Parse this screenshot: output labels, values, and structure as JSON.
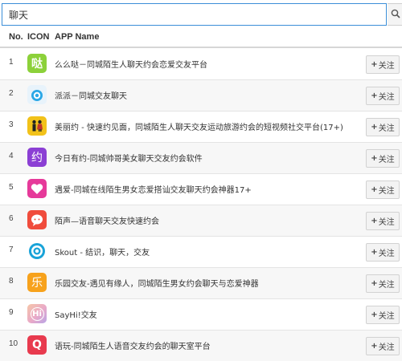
{
  "search": {
    "value": "聊天"
  },
  "table": {
    "headers": {
      "no": "No.",
      "icon": "ICON",
      "app_name": "APP Name"
    },
    "follow_label": "关注",
    "rows": [
      {
        "no": "1",
        "name": "么么哒－同城陌生人聊天约会恋爱交友平台",
        "icon": "momoda-app-icon",
        "icon_text": "哒",
        "icon_color": "#8cd13a"
      },
      {
        "no": "2",
        "name": "派派－同城交友聊天",
        "icon": "paipai-app-icon",
        "icon_text": "",
        "icon_color": "#2aa7e6"
      },
      {
        "no": "3",
        "name": "美丽约 - 快速约见面，同城陌生人聊天交友运动旅游约会的短视频社交平台(17+)",
        "icon": "meiliyue-app-icon",
        "icon_text": "",
        "icon_color": "#f2c21a"
      },
      {
        "no": "4",
        "name": "今日有约-同城帅哥美女聊天交友约会软件",
        "icon": "jinriyouyue-app-icon",
        "icon_text": "约",
        "icon_color": "#8b3fd4"
      },
      {
        "no": "5",
        "name": "遇爱-同城在线陌生男女恋爱搭讪交友聊天约会神器17+",
        "icon": "yuai-app-icon",
        "icon_text": "",
        "icon_color": "#e63a9a"
      },
      {
        "no": "6",
        "name": "陌声—语音聊天交友快速约会",
        "icon": "mosheng-app-icon",
        "icon_text": "",
        "icon_color": "#f04c3c"
      },
      {
        "no": "7",
        "name": "Skout - 结识，聊天，交友",
        "icon": "skout-app-icon",
        "icon_text": "",
        "icon_color": "#19a3d8"
      },
      {
        "no": "8",
        "name": "乐园交友-遇见有缘人，同城陌生男女约会聊天与恋爱神器",
        "icon": "leyuan-app-icon",
        "icon_text": "乐",
        "icon_color": "#f7a21c"
      },
      {
        "no": "9",
        "name": "SayHi!交友",
        "icon": "sayhi-app-icon",
        "icon_text": "Hi",
        "icon_color": "#e9a9c8"
      },
      {
        "no": "10",
        "name": "语玩-同城陌生人语音交友约会的聊天室平台",
        "icon": "yuwan-app-icon",
        "icon_text": "Q",
        "icon_color": "#e83a4e"
      }
    ]
  }
}
